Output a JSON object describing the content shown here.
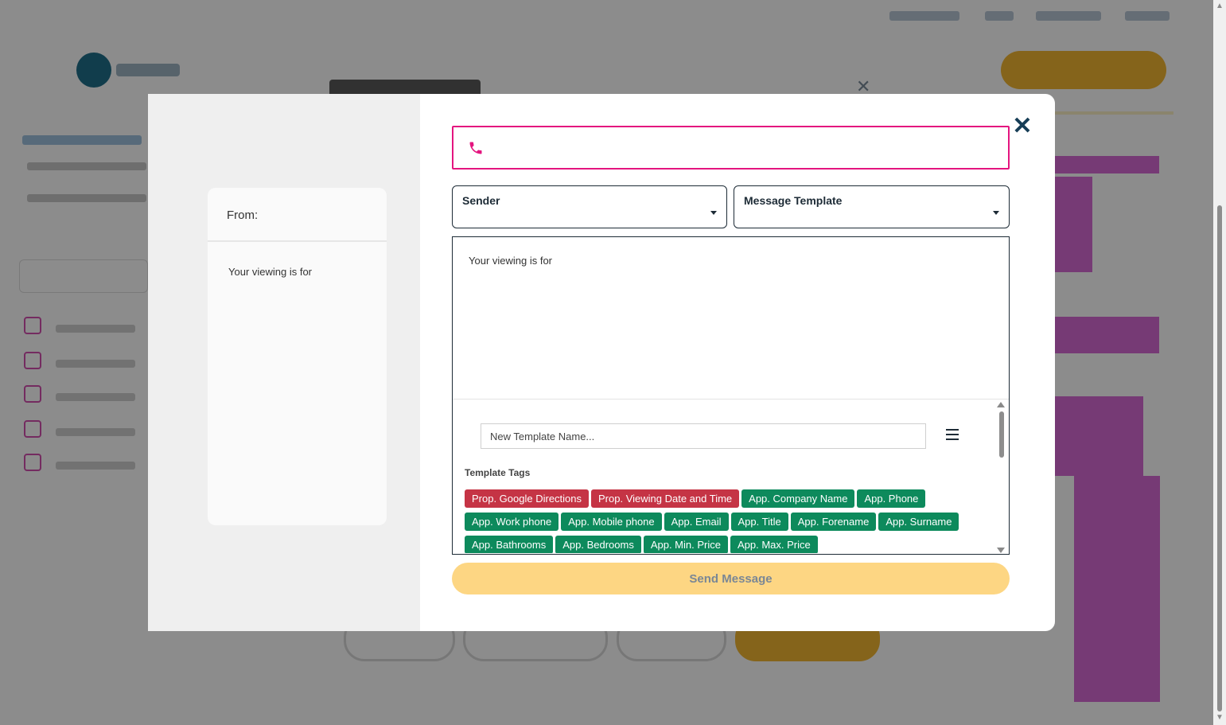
{
  "modal": {
    "preview": {
      "from_label": "From:",
      "body_text": "Your viewing is for"
    },
    "phone_field": {
      "value": ""
    },
    "sender_select": {
      "label": "Sender"
    },
    "template_select": {
      "label": "Message Template"
    },
    "editor": {
      "body_text": "Your viewing is for",
      "template_name_placeholder": "New Template Name...",
      "tags_title": "Template Tags",
      "tags": [
        {
          "label": "Prop. Google Directions",
          "color": "red"
        },
        {
          "label": "Prop. Viewing Date and Time",
          "color": "red"
        },
        {
          "label": "App. Company Name",
          "color": "green"
        },
        {
          "label": "App. Phone",
          "color": "green"
        },
        {
          "label": "App. Work phone",
          "color": "green"
        },
        {
          "label": "App. Mobile phone",
          "color": "green"
        },
        {
          "label": "App. Email",
          "color": "green"
        },
        {
          "label": "App. Title",
          "color": "green"
        },
        {
          "label": "App. Forename",
          "color": "green"
        },
        {
          "label": "App. Surname",
          "color": "green"
        },
        {
          "label": "App. Bathrooms",
          "color": "green"
        },
        {
          "label": "App. Bedrooms",
          "color": "green"
        },
        {
          "label": "App. Min. Price",
          "color": "green"
        },
        {
          "label": "App. Max. Price",
          "color": "green"
        }
      ]
    },
    "send_button_label": "Send Message",
    "icons": {
      "close": "close-icon",
      "phone": "phone-icon",
      "menu": "menu-icon",
      "dropdown": "chevron-down-icon"
    },
    "colors": {
      "phone_border": "#e4157f",
      "tag_red": "#c53445",
      "tag_green": "#0d8a5c",
      "send_button": "#fdd683"
    }
  }
}
